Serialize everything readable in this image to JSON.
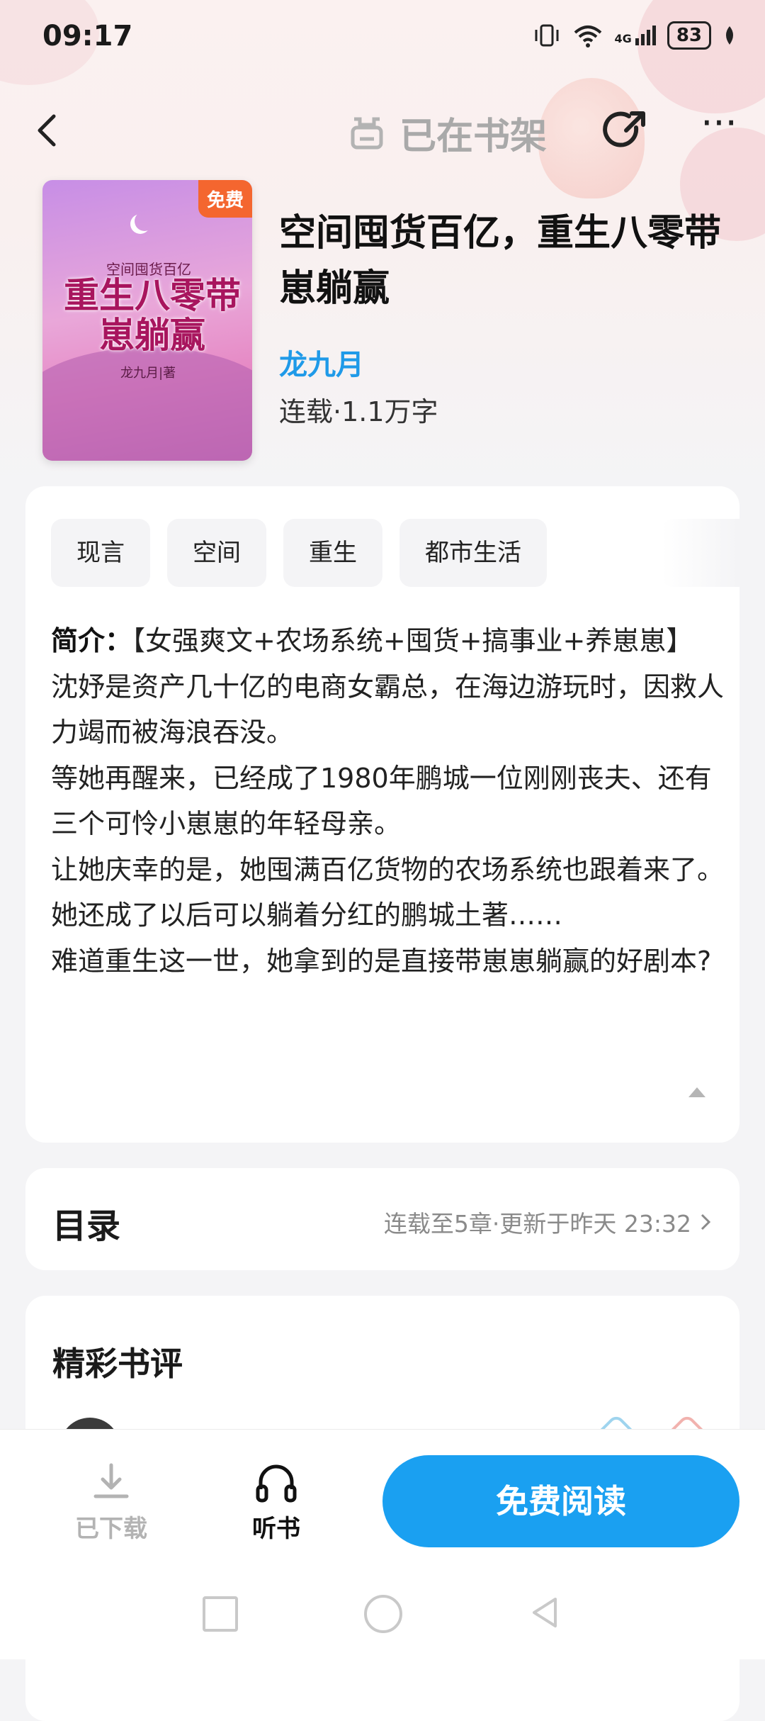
{
  "status_bar": {
    "time": "09:17",
    "network": "4G",
    "battery": "83"
  },
  "nav": {
    "shelf_label": "已在书架"
  },
  "book": {
    "free_tag": "免费",
    "cover_small": "空间囤货百亿",
    "cover_title": "重生八零带崽躺赢",
    "cover_author": "龙九月|著",
    "title": "空间囤货百亿，重生八零带崽躺赢",
    "author": "龙九月",
    "meta": "连载·1.1万字"
  },
  "tags": [
    "现言",
    "空间",
    "重生",
    "都市生活"
  ],
  "intro": {
    "label": "简介：",
    "first_line": "【女强爽文+农场系统+囤货+搞事业+养崽崽】",
    "paragraphs": [
      "沈妤是资产几十亿的电商女霸总，在海边游玩时，因救人力竭而被海浪吞没。",
      "等她再醒来，已经成了1980年鹏城一位刚刚丧夫、还有三个可怜小崽崽的年轻母亲。",
      "让她庆幸的是，她囤满百亿货物的农场系统也跟着来了。",
      "她还成了以后可以躺着分红的鹏城土著……",
      "难道重生这一世，她拿到的是直接带崽崽躺赢的好剧本?"
    ]
  },
  "toc": {
    "title": "目录",
    "info": "连载至5章·更新于昨天 23:32"
  },
  "reviews": {
    "title": "精彩书评"
  },
  "bottom": {
    "download_label": "已下载",
    "listen_label": "听书",
    "read_label": "免费阅读"
  },
  "colors": {
    "accent": "#1aa0f1",
    "author": "#1f9ae8",
    "free_tag": "#f4662f"
  }
}
